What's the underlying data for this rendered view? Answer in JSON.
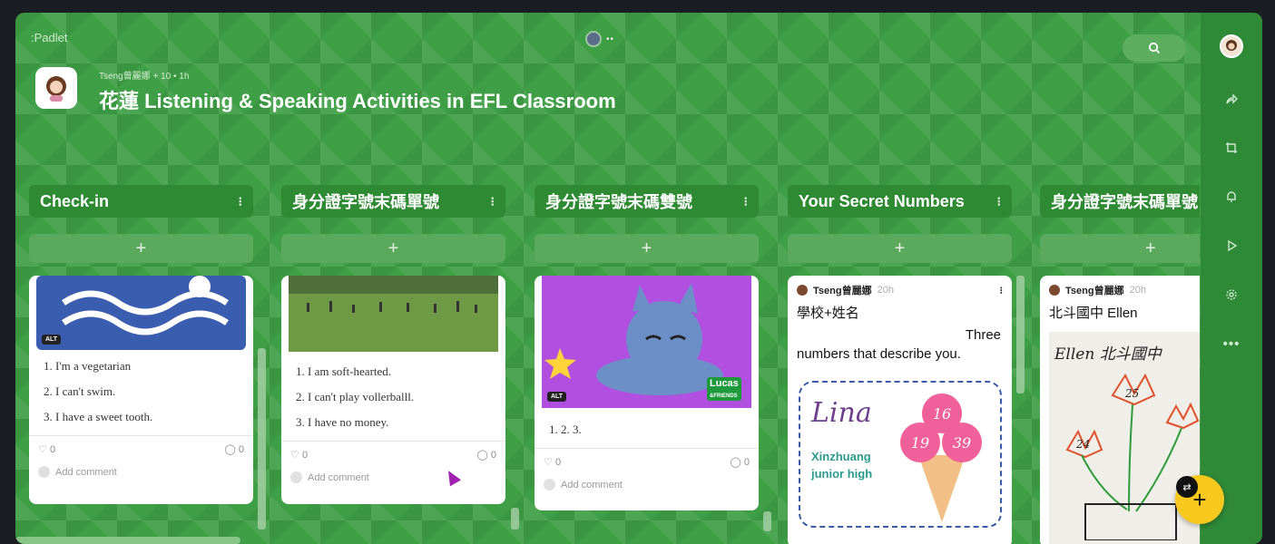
{
  "app": {
    "logo": ":Padlet"
  },
  "topbar": {
    "presence_dots": "••",
    "search_icon": "search-icon"
  },
  "board": {
    "meta": "Tseng曾麗娜 + 10 • 1h",
    "title": "花蓮 Listening & Speaking Activities in EFL Classroom"
  },
  "columns": [
    {
      "title": "Check-in",
      "menu": "⁝",
      "add": "+"
    },
    {
      "title": "身分證字號末碼單號",
      "menu": "⁝",
      "add": "+"
    },
    {
      "title": "身分證字號末碼雙號",
      "menu": "⁝",
      "add": "+"
    },
    {
      "title": "Your Secret Numbers",
      "menu": "⁝",
      "add": "+"
    },
    {
      "title": "身分證字號末碼單號",
      "menu": "⁝",
      "add": "+"
    }
  ],
  "cards": {
    "card1": {
      "alt": "ALT",
      "items": [
        "1. I'm a vegetarian",
        "2. I can't swim.",
        "3. I have a sweet tooth."
      ],
      "likes": "0",
      "comments": "0",
      "add_comment": "Add comment"
    },
    "card2": {
      "items": [
        "1. I am soft-hearted.",
        "2. I can't  play vollerballl.",
        "3. I have no money."
      ],
      "likes": "0",
      "comments": "0",
      "add_comment": "Add comment"
    },
    "card3": {
      "alt": "ALT",
      "brand_top": "Lucas",
      "brand_bottom": "&FRIENDS",
      "items": [
        "1. 2. 3."
      ],
      "likes": "0",
      "comments": "0",
      "add_comment": "Add comment"
    },
    "card4": {
      "author": "Tseng曾麗娜",
      "time": "20h",
      "menu": "⁝",
      "title": "學校+姓名",
      "body_right": "Three",
      "body": "numbers that describe you.",
      "image_name": "Lina",
      "image_school": "Xinzhuang junior high",
      "scoops": [
        "16",
        "19",
        "39"
      ]
    },
    "card5": {
      "author": "Tseng曾麗娜",
      "time": "20h",
      "title": "北斗國中 Ellen",
      "handwriting": "Ellen 北斗國中",
      "flower_numbers": [
        "25",
        "24"
      ]
    }
  },
  "rail": {
    "share_icon": "share-icon",
    "crop_icon": "frame-icon",
    "bell_icon": "bell-icon",
    "play_icon": "play-icon",
    "settings_icon": "gear-icon",
    "more_label": "•••"
  },
  "fab": {
    "label": "+"
  },
  "colors": {
    "board_green": "#3f9f46",
    "header_green": "#2e8a33",
    "fab_yellow": "#f7c91f"
  }
}
